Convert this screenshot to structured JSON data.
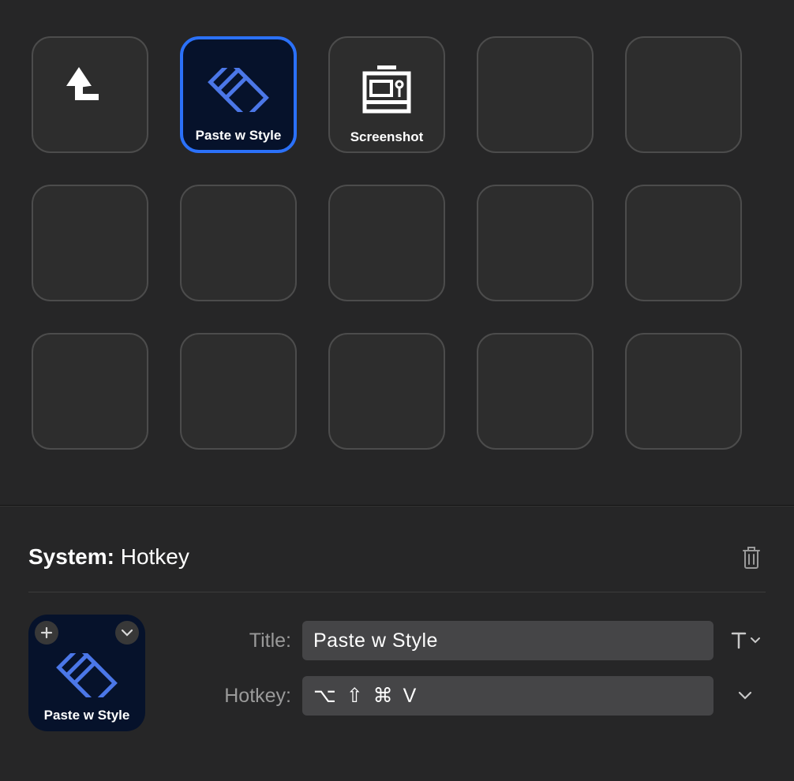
{
  "grid": {
    "slots": [
      {
        "id": "slot-0",
        "label": "",
        "icon": "back-up-arrow",
        "selected": false
      },
      {
        "id": "slot-1",
        "label": "Paste w Style",
        "icon": "paste-style",
        "selected": true
      },
      {
        "id": "slot-2",
        "label": "Screenshot",
        "icon": "screenshot",
        "selected": false
      },
      {
        "id": "slot-3",
        "label": "",
        "icon": null,
        "selected": false
      },
      {
        "id": "slot-4",
        "label": "",
        "icon": null,
        "selected": false
      },
      {
        "id": "slot-5",
        "label": "",
        "icon": null,
        "selected": false
      },
      {
        "id": "slot-6",
        "label": "",
        "icon": null,
        "selected": false
      },
      {
        "id": "slot-7",
        "label": "",
        "icon": null,
        "selected": false
      },
      {
        "id": "slot-8",
        "label": "",
        "icon": null,
        "selected": false
      },
      {
        "id": "slot-9",
        "label": "",
        "icon": null,
        "selected": false
      },
      {
        "id": "slot-10",
        "label": "",
        "icon": null,
        "selected": false
      },
      {
        "id": "slot-11",
        "label": "",
        "icon": null,
        "selected": false
      },
      {
        "id": "slot-12",
        "label": "",
        "icon": null,
        "selected": false
      },
      {
        "id": "slot-13",
        "label": "",
        "icon": null,
        "selected": false
      },
      {
        "id": "slot-14",
        "label": "",
        "icon": null,
        "selected": false
      }
    ]
  },
  "inspector": {
    "section_prefix": "System:",
    "section_name": "Hotkey",
    "title_label": "Title:",
    "title_value": "Paste w Style",
    "hotkey_label": "Hotkey:",
    "hotkey_value": "⌥ ⇧ ⌘ V",
    "preview_label": "Paste w Style"
  }
}
